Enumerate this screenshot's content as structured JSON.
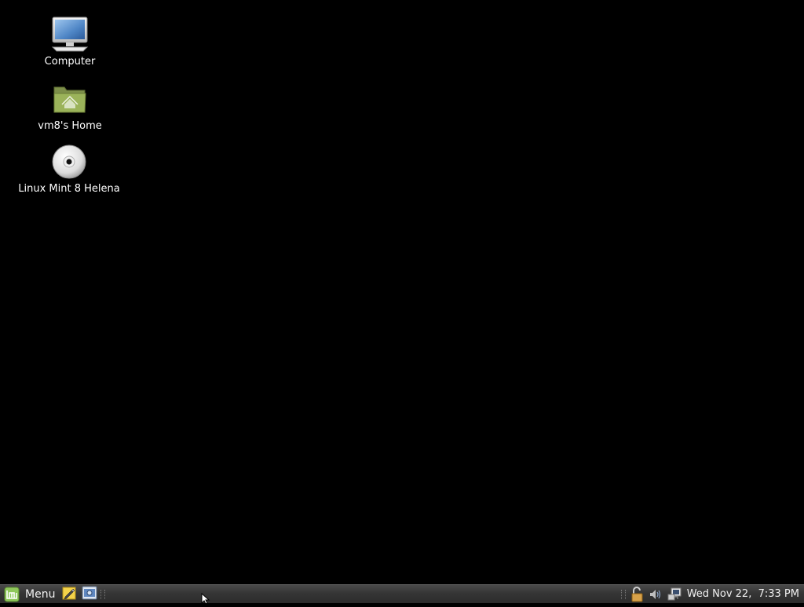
{
  "desktop": {
    "background_color": "#000000",
    "icons": [
      {
        "label": "Computer",
        "icon": "computer-icon"
      },
      {
        "label": "vm8's Home",
        "icon": "home-folder-icon"
      },
      {
        "label": "Linux Mint 8 Helena",
        "icon": "dvd-disc-icon"
      }
    ]
  },
  "panel": {
    "menu_label": "Menu",
    "menu_icon": "linux-mint-logo-icon",
    "launchers": [
      {
        "icon": "text-editor-icon"
      },
      {
        "icon": "screenshot-tool-icon"
      }
    ],
    "tray": [
      {
        "icon": "update-manager-lock-icon"
      },
      {
        "icon": "volume-icon"
      },
      {
        "icon": "network-icon"
      }
    ],
    "clock": "Wed Nov 22,  7:33 PM"
  }
}
